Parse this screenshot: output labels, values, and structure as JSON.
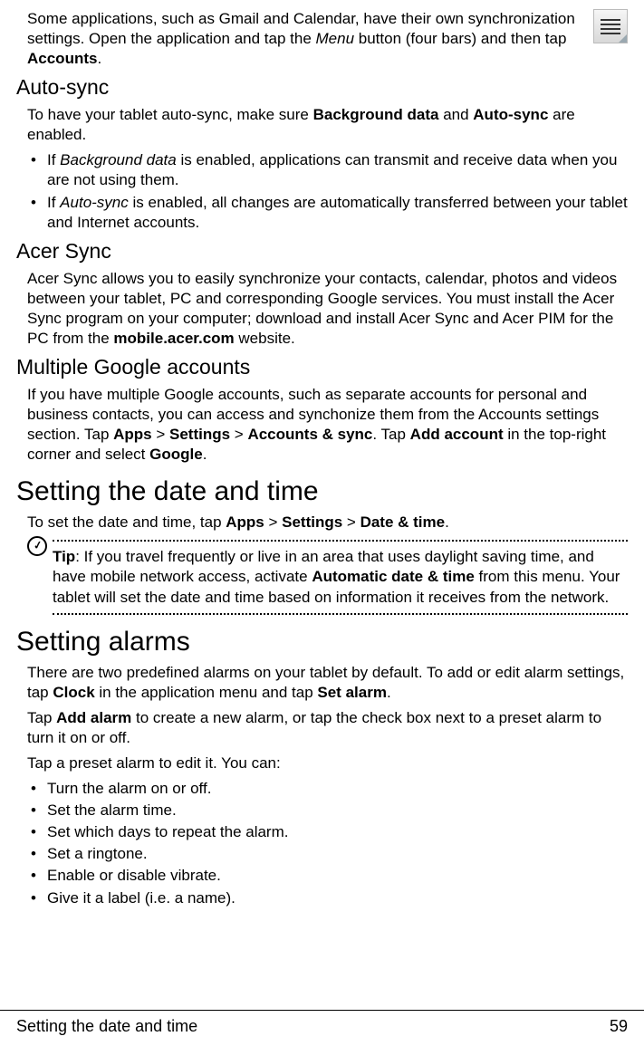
{
  "intro": {
    "p1_a": "Some applications, such as Gmail and Calendar, have their own synchronization settings. Open the application and tap the ",
    "menu_word": "Menu",
    "p1_b": " button (four bars) and then tap ",
    "accounts_word": "Accounts",
    "p1_c": "."
  },
  "autosync": {
    "heading": "Auto-sync",
    "p_a": "To have your tablet auto-sync, make sure ",
    "bold1": "Background data",
    "p_b": " and ",
    "bold2": "Auto-sync",
    "p_c": " are enabled.",
    "bullet1_a": "If ",
    "bullet1_i": "Background data",
    "bullet1_b": " is enabled, applications can transmit and receive data when you are not using them.",
    "bullet2_a": "If ",
    "bullet2_i": "Auto-sync",
    "bullet2_b": " is enabled, all changes are automatically transferred between your tablet and Internet accounts."
  },
  "acersync": {
    "heading": "Acer Sync",
    "p_a": "Acer Sync allows you to easily synchronize your contacts, calendar, photos and videos between your tablet, PC and corresponding Google services. You must install the Acer Sync program on your computer; download and install Acer Sync and Acer PIM for the PC from the ",
    "bold1": "mobile.acer.com",
    "p_b": " website."
  },
  "multigoogle": {
    "heading": "Multiple Google accounts",
    "p_a": "If you have multiple Google accounts, such as separate accounts for personal and business contacts, you can access and synchonize them from the Accounts settings section. Tap ",
    "b1": "Apps",
    "gt1": " > ",
    "b2": "Settings",
    "gt2": " > ",
    "b3": "Accounts & sync",
    "p_b": ". Tap ",
    "b4": "Add account",
    "p_c": " in the top-right corner and select ",
    "b5": "Google",
    "p_d": "."
  },
  "datetime": {
    "heading": "Setting the date and time",
    "p_a": "To set the date and time, tap ",
    "b1": "Apps",
    "gt1": " > ",
    "b2": "Settings",
    "gt2": " > ",
    "b3": "Date & time",
    "p_b": ".",
    "tip_label": "Tip",
    "tip_a": ": If you travel frequently or live in an area that uses daylight saving time, and have mobile network access, activate ",
    "tip_bold": "Automatic date & time",
    "tip_b": " from this menu. Your tablet will set the date and time based on information it receives from the network."
  },
  "alarms": {
    "heading": "Setting alarms",
    "p1_a": "There are two predefined alarms on your tablet by default. To add or edit alarm settings, tap ",
    "b1": "Clock",
    "p1_b": " in the application menu and tap ",
    "b2": "Set alarm",
    "p1_c": ".",
    "p2_a": "Tap ",
    "b3": "Add alarm",
    "p2_b": " to create a new alarm, or tap the check box next to a preset alarm to turn it on or off.",
    "p3": "Tap a preset alarm to edit it. You can:",
    "items": [
      "Turn the alarm on or off.",
      "Set the alarm time.",
      "Set which days to repeat the alarm.",
      "Set a ringtone.",
      "Enable or disable vibrate.",
      "Give it a label (i.e. a name)."
    ]
  },
  "footer": {
    "left": "Setting the date and time",
    "right": "59"
  }
}
